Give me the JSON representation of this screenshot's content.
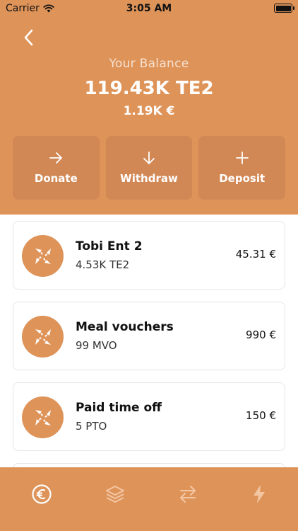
{
  "status": {
    "carrier": "Carrier",
    "time": "3:05 AM"
  },
  "balance": {
    "label": "Your Balance",
    "amount": "119.43K TE2",
    "fiat": "1.19K €"
  },
  "actions": [
    {
      "label": "Donate",
      "icon": "arrow-right-icon"
    },
    {
      "label": "Withdraw",
      "icon": "arrow-down-icon"
    },
    {
      "label": "Deposit",
      "icon": "plus-icon"
    }
  ],
  "assets": [
    {
      "name": "Tobi Ent 2",
      "amount": "4.53K TE2",
      "fiat": "45.31 €"
    },
    {
      "name": "Meal vouchers",
      "amount": "99 MVO",
      "fiat": "990 €"
    },
    {
      "name": "Paid time off",
      "amount": "5 PTO",
      "fiat": "150 €"
    }
  ],
  "tabs": [
    {
      "icon": "euro-icon",
      "active": true
    },
    {
      "icon": "layers-icon",
      "active": false
    },
    {
      "icon": "transfer-icon",
      "active": false
    },
    {
      "icon": "lightning-icon",
      "active": false
    }
  ],
  "colors": {
    "accent": "#DE9359",
    "button": "#D28855",
    "card_border": "#E6E6E6"
  }
}
